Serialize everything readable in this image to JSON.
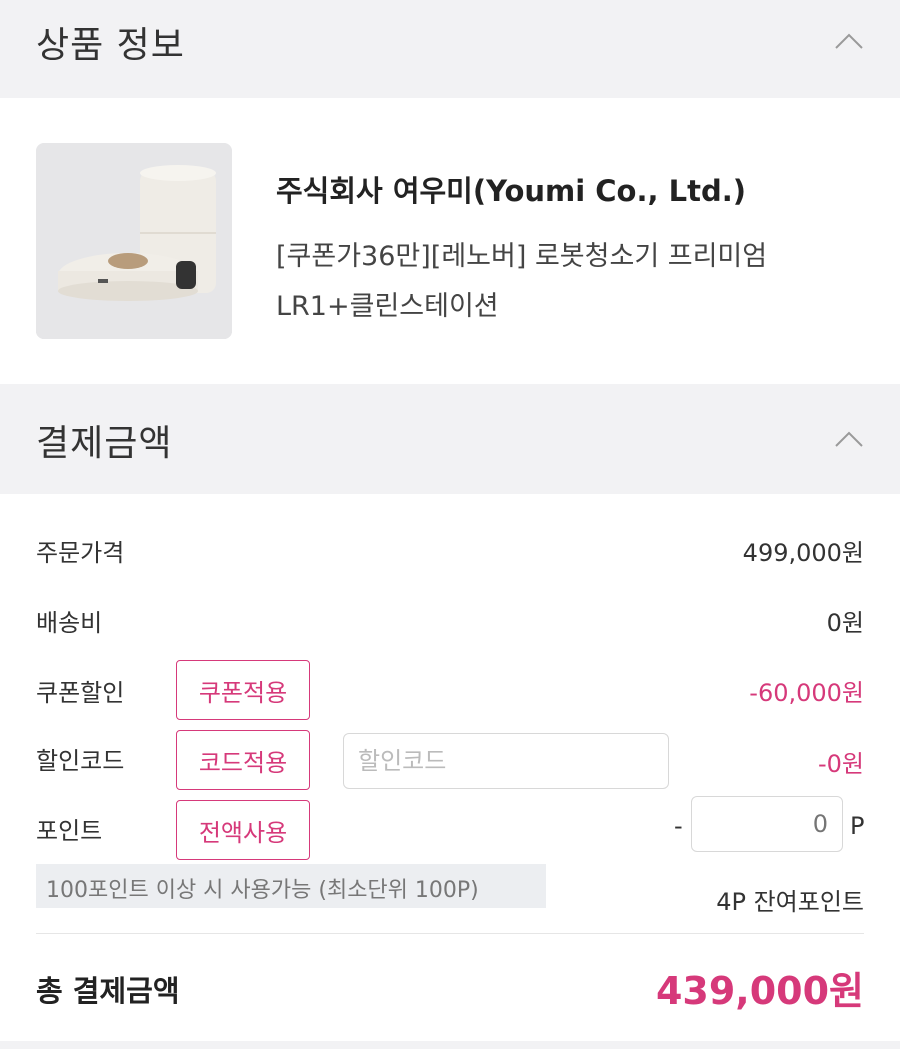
{
  "product_section": {
    "title": "상품 정보",
    "seller": "주식회사 여우미(Youmi Co., Ltd.)",
    "name_line1": "[쿠폰가36만][레노버] 로봇청소기 프리미엄",
    "name_line2": "LR1+클린스테이션"
  },
  "payment_section": {
    "title": "결제금액",
    "order_price": {
      "label": "주문가격",
      "value": "499,000원"
    },
    "shipping": {
      "label": "배송비",
      "value": "0원"
    },
    "coupon": {
      "label": "쿠폰할인",
      "button": "쿠폰적용",
      "value": "-60,000원"
    },
    "discount_code": {
      "label": "할인코드",
      "button": "코드적용",
      "placeholder": "할인코드",
      "value": "-0원"
    },
    "points": {
      "label": "포인트",
      "button": "전액사용",
      "dash": "-",
      "input_value": "0",
      "unit": "P"
    },
    "points_notice": "100포인트 이상 시 사용가능 (최소단위 100P)",
    "remaining_points": "4P 잔여포인트",
    "total": {
      "label": "총 결제금액",
      "value": "439,000원"
    }
  },
  "colors": {
    "accent": "#d6397a",
    "header_bg": "#f2f2f4"
  },
  "icons": {
    "collapse": "chevron-up-icon"
  }
}
